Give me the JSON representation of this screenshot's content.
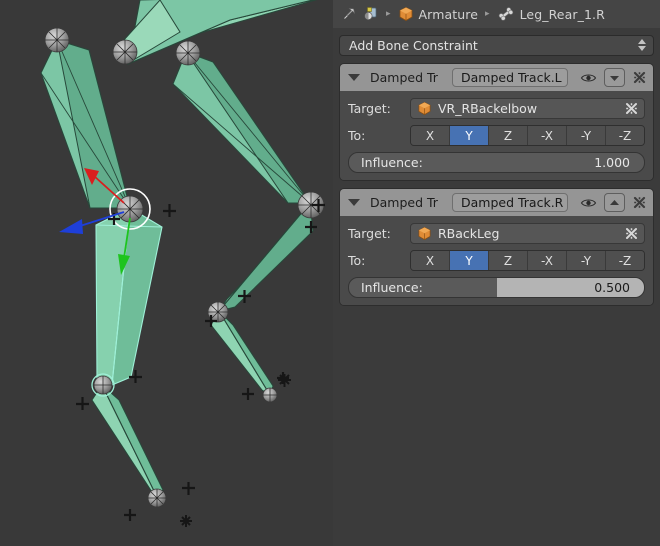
{
  "breadcrumb": {
    "pin_icon": "pin-icon",
    "editor_icon": "properties-editor-icon",
    "items": [
      {
        "icon": "object-data-icon",
        "label": "Armature"
      },
      {
        "icon": "bone-icon",
        "label": "Leg_Rear_1.R"
      }
    ],
    "separator": "▸"
  },
  "panel": {
    "add_constraint_label": "Add Bone Constraint"
  },
  "constraints": [
    {
      "type_label": "Damped Tr",
      "name": "Damped Track.L",
      "expand_icon": "chevron-down-icon",
      "visibility_icon": "eye-icon",
      "move_icon": "chevron-down-icon",
      "close_icon": "close-x-icon",
      "target_label": "Target:",
      "target_icon": "object-data-icon",
      "target_value": "VR_RBackelbow",
      "target_clear_icon": "clear-x-icon",
      "to_label": "To:",
      "axes": [
        "X",
        "Y",
        "Z",
        "-X",
        "-Y",
        "-Z"
      ],
      "active_axis": "Y",
      "influence_label": "Influence:",
      "influence_value": "1.000",
      "influence_fraction": 1.0
    },
    {
      "type_label": "Damped Tr",
      "name": "Damped Track.R",
      "expand_icon": "chevron-down-icon",
      "visibility_icon": "eye-icon",
      "move_icon": "chevron-up-icon",
      "close_icon": "close-x-icon",
      "target_label": "Target:",
      "target_icon": "object-data-icon",
      "target_value": "RBackLeg",
      "target_clear_icon": "clear-x-icon",
      "to_label": "To:",
      "axes": [
        "X",
        "Y",
        "Z",
        "-X",
        "-Y",
        "-Z"
      ],
      "active_axis": "Y",
      "influence_label": "Influence:",
      "influence_value": "0.500",
      "influence_fraction": 0.5
    }
  ],
  "viewport": {
    "background_color": "#393939",
    "bone_fill": "#7cc6a5",
    "bone_fill_light": "#9ad9b9",
    "bone_fill_dark": "#62ad8c",
    "bone_selected_outline": "#8fe8d2",
    "joint_ball": "#9b9b9b",
    "gizmo": {
      "x_axis_color": "#d91e1e",
      "y_axis_color": "#1ec41e",
      "z_axis_color": "#1e3fd9"
    }
  },
  "colors": {
    "accent_blue": "#4772b3",
    "panel_header": "#959595",
    "panel_body": "#4a4a4a",
    "editor_bg": "#3b3b3b",
    "header_bg": "#454545"
  }
}
